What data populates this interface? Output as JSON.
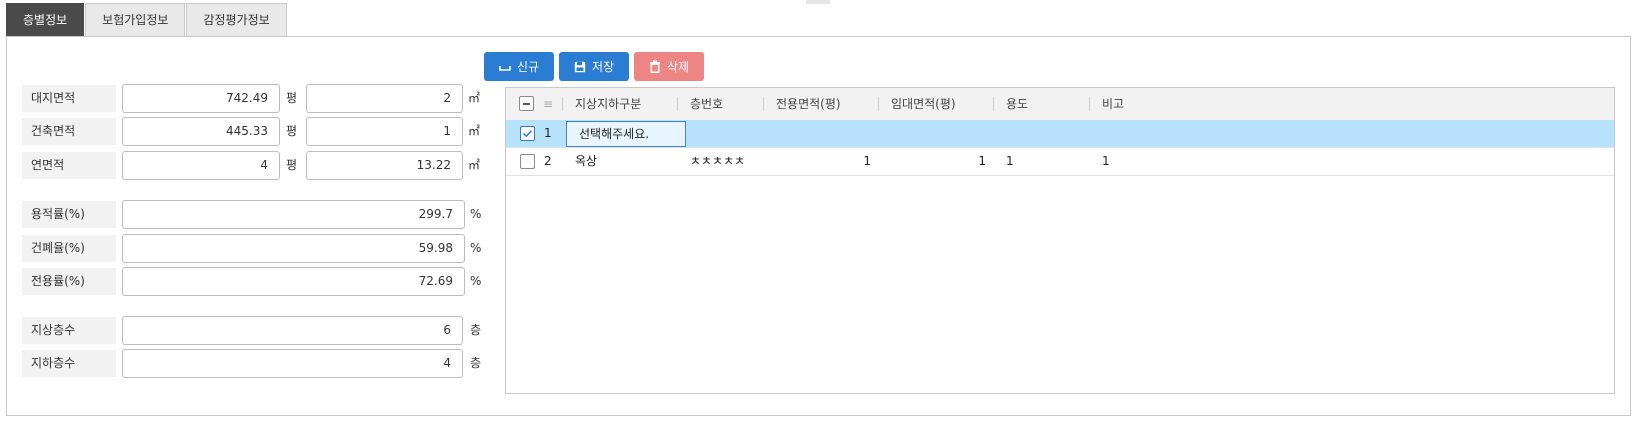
{
  "tabs": [
    "층별정보",
    "보험가입정보",
    "감정평가정보"
  ],
  "area_fields": [
    {
      "label": "대지면적",
      "value_py": "742.49",
      "unit_py": "평",
      "value_m2": "2",
      "unit_m2": "㎡"
    },
    {
      "label": "건축면적",
      "value_py": "445.33",
      "unit_py": "평",
      "value_m2": "1",
      "unit_m2": "㎡"
    },
    {
      "label": "연면적",
      "value_py": "4",
      "unit_py": "평",
      "value_m2": "13.22",
      "unit_m2": "㎡"
    }
  ],
  "ratio_fields": [
    {
      "label": "용적률(%)",
      "value": "299.7",
      "unit": "%"
    },
    {
      "label": "건폐율(%)",
      "value": "59.98",
      "unit": "%"
    },
    {
      "label": "전용률(%)",
      "value": "72.69",
      "unit": "%"
    }
  ],
  "floor_fields": [
    {
      "label": "지상층수",
      "value": "6",
      "unit": "층"
    },
    {
      "label": "지하층수",
      "value": "4",
      "unit": "층"
    }
  ],
  "toolbar": {
    "new_label": "신규",
    "save_label": "저장",
    "delete_label": "삭제",
    "colors": {
      "new": "#2b7cd3",
      "save": "#2b7cd3",
      "delete": "#ee8585"
    }
  },
  "grid": {
    "headers": [
      "지상지하구분",
      "층번호",
      "전용면적(평)",
      "임대면적(평)",
      "용도",
      "비고"
    ],
    "rows": [
      {
        "no": "1",
        "checked": true,
        "type": "선택해주세요.",
        "floor": "",
        "exclusive": "",
        "rental": "",
        "usage": "",
        "note": ""
      },
      {
        "no": "2",
        "checked": false,
        "type": "옥상",
        "floor": "ㅊㅊㅊㅊㅊ",
        "exclusive": "1",
        "rental": "1",
        "usage": "1",
        "note": "1"
      }
    ],
    "selected_color": "#b8e1fb"
  }
}
